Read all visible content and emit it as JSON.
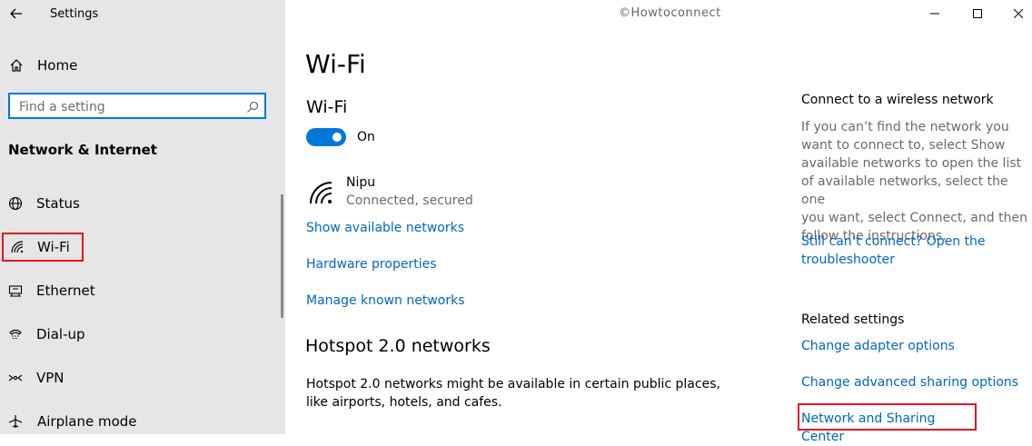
{
  "window": {
    "title": "Settings",
    "watermark": "©Howtoconnect"
  },
  "sidebar": {
    "home_label": "Home",
    "search_placeholder": "Find a setting",
    "section_title": "Network & Internet",
    "items": [
      {
        "label": "Status",
        "icon": "globe-icon"
      },
      {
        "label": "Wi-Fi",
        "icon": "wifi-icon",
        "selected": true
      },
      {
        "label": "Ethernet",
        "icon": "ethernet-icon"
      },
      {
        "label": "Dial-up",
        "icon": "dialup-icon"
      },
      {
        "label": "VPN",
        "icon": "vpn-icon"
      },
      {
        "label": "Airplane mode",
        "icon": "airplane-icon"
      }
    ]
  },
  "main": {
    "page_title": "Wi-Fi",
    "wifi_heading": "Wi-Fi",
    "toggle_state": "On",
    "network": {
      "name": "Nipu",
      "status": "Connected, secured"
    },
    "links": {
      "show_available": "Show available networks",
      "hardware_properties": "Hardware properties",
      "manage_known": "Manage known networks"
    },
    "hotspot": {
      "heading": "Hotspot 2.0 networks",
      "text_line1": "Hotspot 2.0 networks might be available in certain public places,",
      "text_line2": "like airports, hotels, and cafes."
    }
  },
  "right_panel": {
    "connect_heading": "Connect to a wireless network",
    "connect_text_lines": [
      "If you can’t find the network you",
      "want to connect to, select Show",
      "available networks to open the list",
      "of available networks, select the one",
      "you want, select Connect, and then",
      "follow the instructions."
    ],
    "troubleshoot_line1": "Still can’t connect? Open the",
    "troubleshoot_line2": "troubleshooter",
    "related_heading": "Related settings",
    "related_links": [
      "Change adapter options",
      "Change advanced sharing options",
      "Network and Sharing Center"
    ]
  },
  "colors": {
    "accent": "#0078d7",
    "link": "#0067c0",
    "highlight": "#e81123",
    "sidebar_bg": "#e6e6e6"
  }
}
